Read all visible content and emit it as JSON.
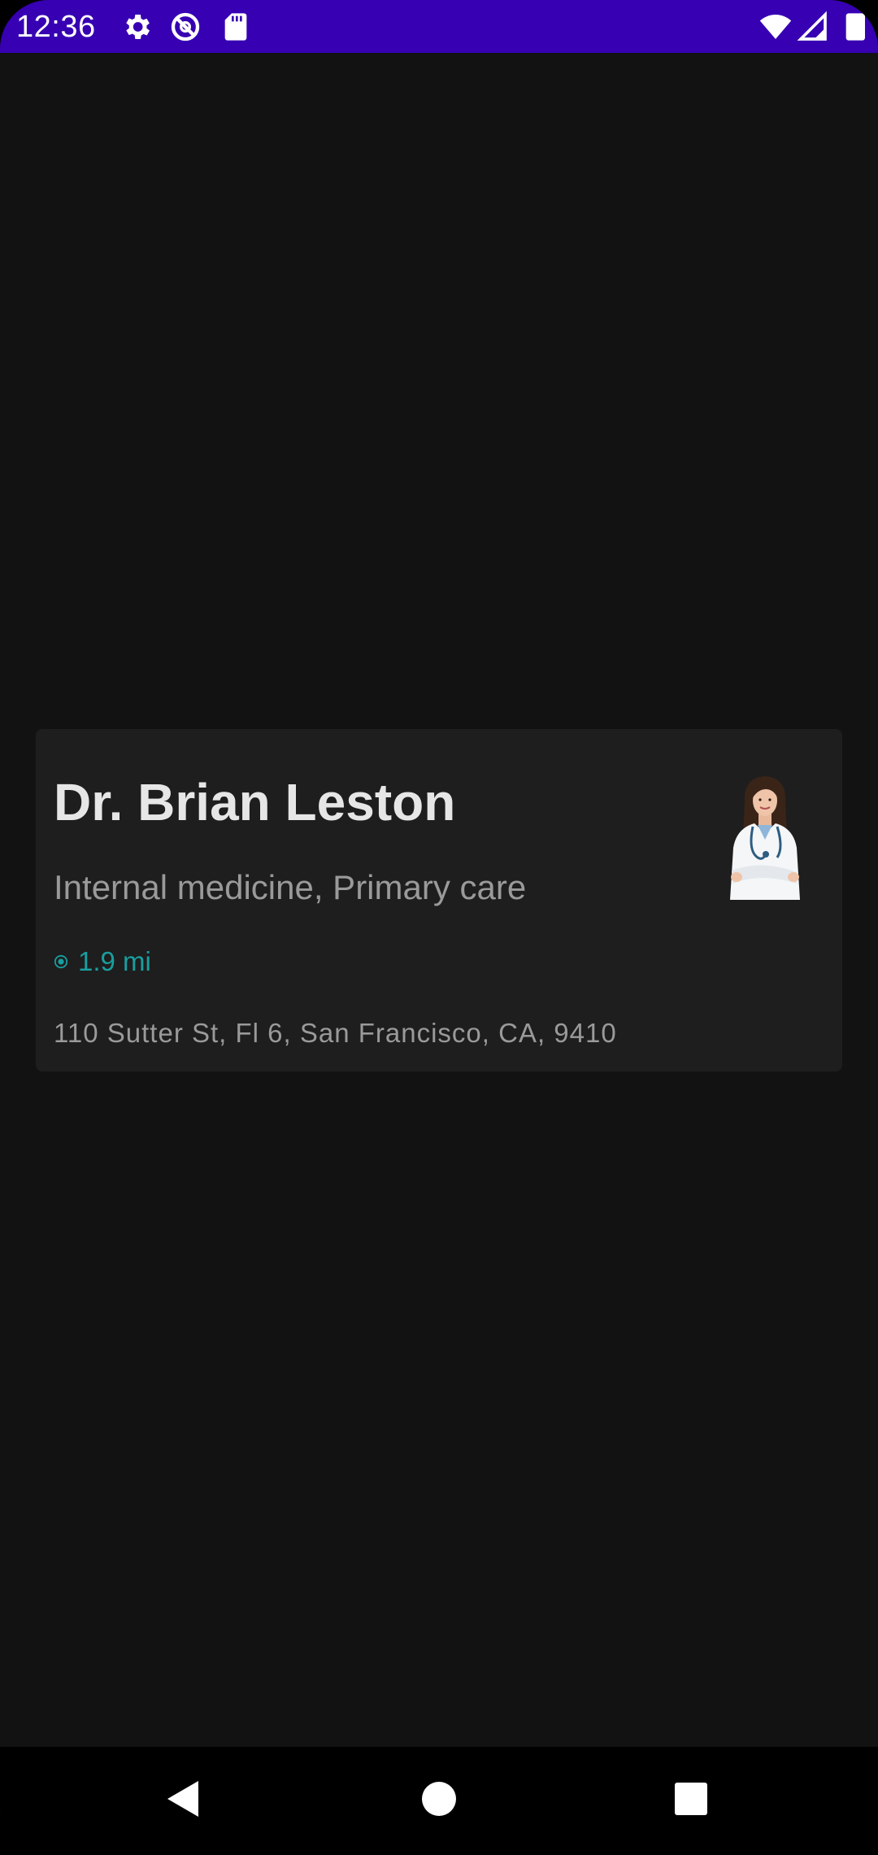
{
  "status_bar": {
    "time": "12:36",
    "icons": [
      "gear-icon",
      "do-not-disturb-icon",
      "sd-card-icon",
      "wifi-icon",
      "cell-signal-icon",
      "battery-icon"
    ],
    "background_color": "#3700b3"
  },
  "card": {
    "name": "Dr. Brian Leston",
    "specialty": "Internal medicine, Primary care",
    "distance": "1.9 mi",
    "address": "110 Sutter St, Fl 6, San Francisco, CA, 9410",
    "accent_color": "#1a9e9e",
    "photo_icon": "doctor-portrait"
  },
  "nav_bar": {
    "buttons": [
      "back-icon",
      "home-icon",
      "recents-icon"
    ]
  }
}
